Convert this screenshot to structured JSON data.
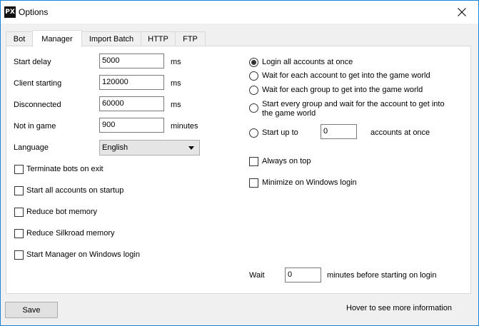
{
  "window": {
    "title": "Options",
    "icon_text": "PX"
  },
  "tabs": [
    {
      "label": "Bot",
      "active": false
    },
    {
      "label": "Manager",
      "active": true
    },
    {
      "label": "Import Batch",
      "active": false
    },
    {
      "label": "HTTP",
      "active": false
    },
    {
      "label": "FTP",
      "active": false
    }
  ],
  "fields": {
    "start_delay": {
      "label": "Start delay",
      "value": "5000",
      "unit": "ms"
    },
    "client_starting": {
      "label": "Client starting",
      "value": "120000",
      "unit": "ms"
    },
    "disconnected": {
      "label": "Disconnected",
      "value": "60000",
      "unit": "ms"
    },
    "not_in_game": {
      "label": "Not in game",
      "value": "900",
      "unit": "minutes"
    },
    "language": {
      "label": "Language",
      "value": "English"
    }
  },
  "checkboxes": {
    "terminate_bots": {
      "label": "Terminate bots on exit",
      "checked": false
    },
    "start_all_accounts": {
      "label": "Start all accounts on startup",
      "checked": false
    },
    "reduce_bot_memory": {
      "label": "Reduce bot memory",
      "checked": false
    },
    "reduce_silkroad_memory": {
      "label": "Reduce Silkroad memory",
      "checked": false
    },
    "start_manager_login": {
      "label": "Start Manager on Windows login",
      "checked": false
    },
    "always_on_top": {
      "label": "Always on top",
      "checked": false
    },
    "minimize_login": {
      "label": "Minimize on Windows login",
      "checked": false
    }
  },
  "radios": {
    "login_all": {
      "label": "Login all accounts at once",
      "checked": true
    },
    "wait_each_account": {
      "label": "Wait for each account to get into the game world",
      "checked": false
    },
    "wait_each_group": {
      "label": "Wait for each group to get into the game world",
      "checked": false
    },
    "start_every_group_line1": "Start every group and wait for the account to get into",
    "start_every_group_line2": "the game world",
    "start_up_to": {
      "label": "Start up to",
      "value": "0",
      "suffix": "accounts at once",
      "checked": false
    }
  },
  "wait": {
    "label": "Wait",
    "value": "0",
    "suffix": "minutes before starting on login"
  },
  "footer": {
    "save_label": "Save",
    "hint": "Hover to see more information"
  }
}
